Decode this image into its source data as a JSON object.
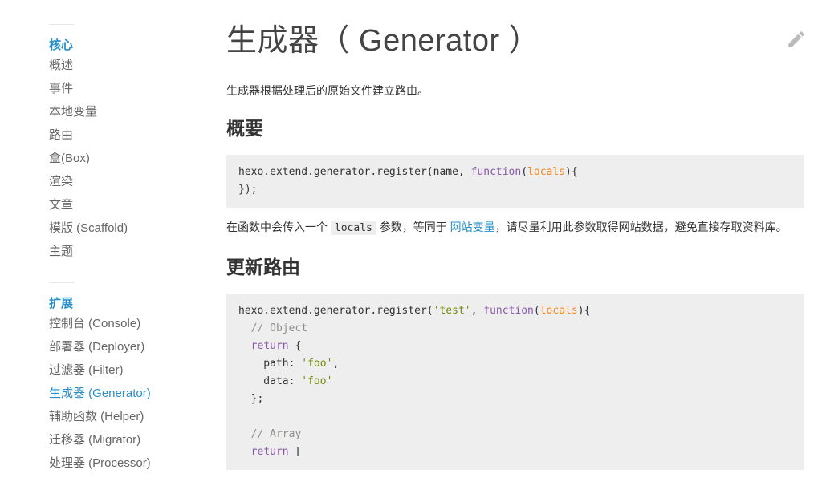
{
  "sidebar": {
    "sections": [
      {
        "title": "核心",
        "items": [
          "概述",
          "事件",
          "本地变量",
          "路由",
          "盒(Box)",
          "渲染",
          "文章",
          "模版 (Scaffold)",
          "主题"
        ]
      },
      {
        "title": "扩展",
        "items": [
          "控制台 (Console)",
          "部署器 (Deployer)",
          "过滤器 (Filter)",
          "生成器 (Generator)",
          "辅助函数 (Helper)",
          "迁移器 (Migrator)",
          "处理器 (Processor)"
        ]
      }
    ],
    "active_item": "生成器 (Generator)"
  },
  "main": {
    "title": "生成器（ Generator ）",
    "intro": "生成器根据处理后的原始文件建立路由。",
    "sections": [
      {
        "heading": "概要"
      },
      {
        "heading": "更新路由"
      }
    ],
    "code1": {
      "line1_prefix": "hexo.extend.generator.register(name, ",
      "kw_function": "function",
      "paren_open": "(",
      "arg_locals": "locals",
      "line1_suffix": "){",
      "line2": "});"
    },
    "para": {
      "t1": "在函数中会传入一个 ",
      "code": "locals",
      "t2": " 参数，等同于 ",
      "link": "网站变量",
      "t3": "，请尽量利用此参数取得网站数据，避免直接存取资料库。"
    },
    "code2": {
      "l1_prefix": "hexo.extend.generator.register(",
      "l1_str": "'test'",
      "l1_comma": ", ",
      "l1_kw": "function",
      "l1_paren": "(",
      "l1_arg": "locals",
      "l1_suffix": "){",
      "l2": "  // Object",
      "l3_indent": "  ",
      "l3_kw": "return",
      "l3_rest": " {",
      "l4_key": "    path: ",
      "l4_val": "'foo'",
      "l4_end": ",",
      "l5_key": "    data: ",
      "l5_val": "'foo'",
      "l6": "  };",
      "l8": "  // Array",
      "l9_indent": "  ",
      "l9_kw": "return",
      "l9_rest": " ["
    }
  },
  "icons": {
    "edit": "pencil-icon"
  },
  "colors": {
    "accent": "#2a8fc7",
    "code_bg": "#eeeeee",
    "keyword": "#8959a8",
    "argument": "#f5871f",
    "string": "#718c00",
    "comment": "#8e908c"
  }
}
